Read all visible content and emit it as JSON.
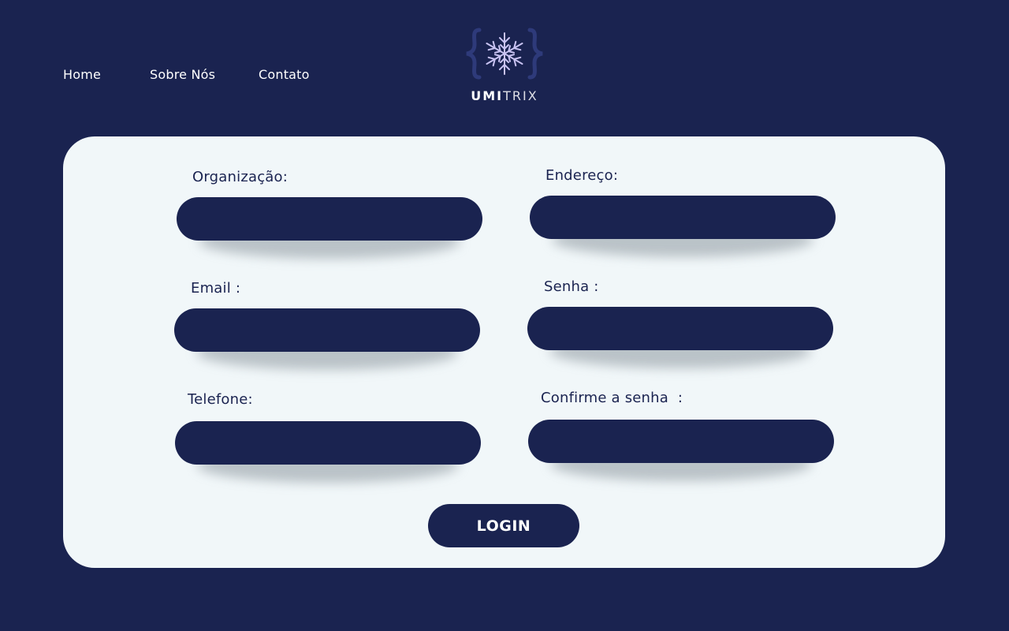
{
  "nav": {
    "items": [
      {
        "label": "Home"
      },
      {
        "label": "Sobre Nós"
      },
      {
        "label": "Contato"
      }
    ]
  },
  "brand": {
    "name_bold": "UMI",
    "name_light": "TRIX",
    "icon": "snowflake-icon",
    "accent_color": "#c9c3f2",
    "brace_color": "#2e3a7a"
  },
  "form": {
    "fields": [
      {
        "label": "Organização:",
        "value": ""
      },
      {
        "label": "Endereço:",
        "value": ""
      },
      {
        "label": "Email :",
        "value": ""
      },
      {
        "label": "Senha :",
        "value": ""
      },
      {
        "label": "Telefone:",
        "value": ""
      },
      {
        "label": "Confirme a senha  :",
        "value": ""
      }
    ],
    "submit_label": "LOGIN"
  },
  "colors": {
    "background": "#1a2350",
    "card": "#f1f7f9",
    "text_on_dark": "#ffffff"
  }
}
